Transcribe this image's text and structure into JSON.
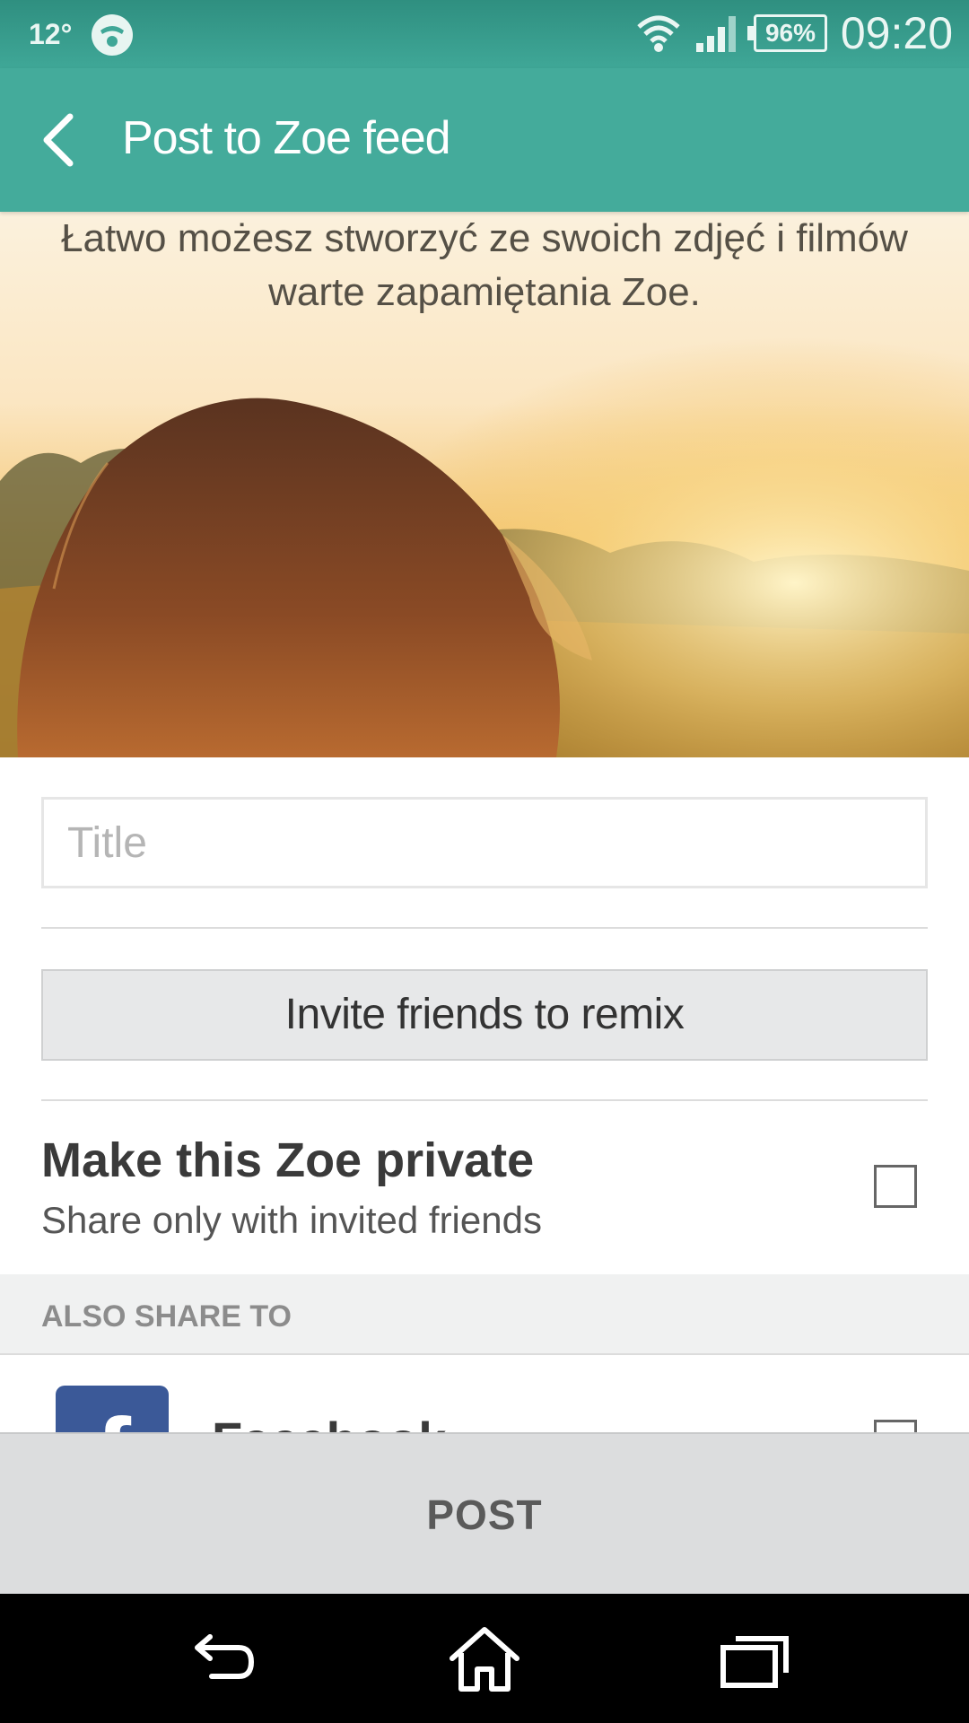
{
  "status_bar": {
    "temperature": "12°",
    "battery": "96%",
    "time": "09:20",
    "icons": [
      "face-icon",
      "wifi-icon",
      "signal-icon",
      "battery-icon"
    ]
  },
  "app_bar": {
    "title": "Post to Zoe feed",
    "back_icon": "back-arrow-icon"
  },
  "hero": {
    "caption": "Łatwo możesz stworzyć ze swoich zdjęć i filmów warte zapamiętania Zoe."
  },
  "form": {
    "title_placeholder": "Title",
    "title_value": "",
    "invite_label": "Invite friends to remix",
    "private_title": "Make this Zoe private",
    "private_subtitle": "Share only with invited friends",
    "private_checked": false
  },
  "also_share": {
    "header": "ALSO SHARE TO",
    "items": [
      {
        "label": "Facebook",
        "icon": "facebook-icon",
        "icon_glyph": "f",
        "checked": false
      }
    ]
  },
  "post_label": "POST",
  "nav": {
    "icons": [
      "back-icon",
      "home-icon",
      "recents-icon"
    ]
  },
  "colors": {
    "status_bar": "#3fa797",
    "app_bar": "#44ab9b",
    "facebook": "#3b5998",
    "post_bar": "#dcddde"
  }
}
